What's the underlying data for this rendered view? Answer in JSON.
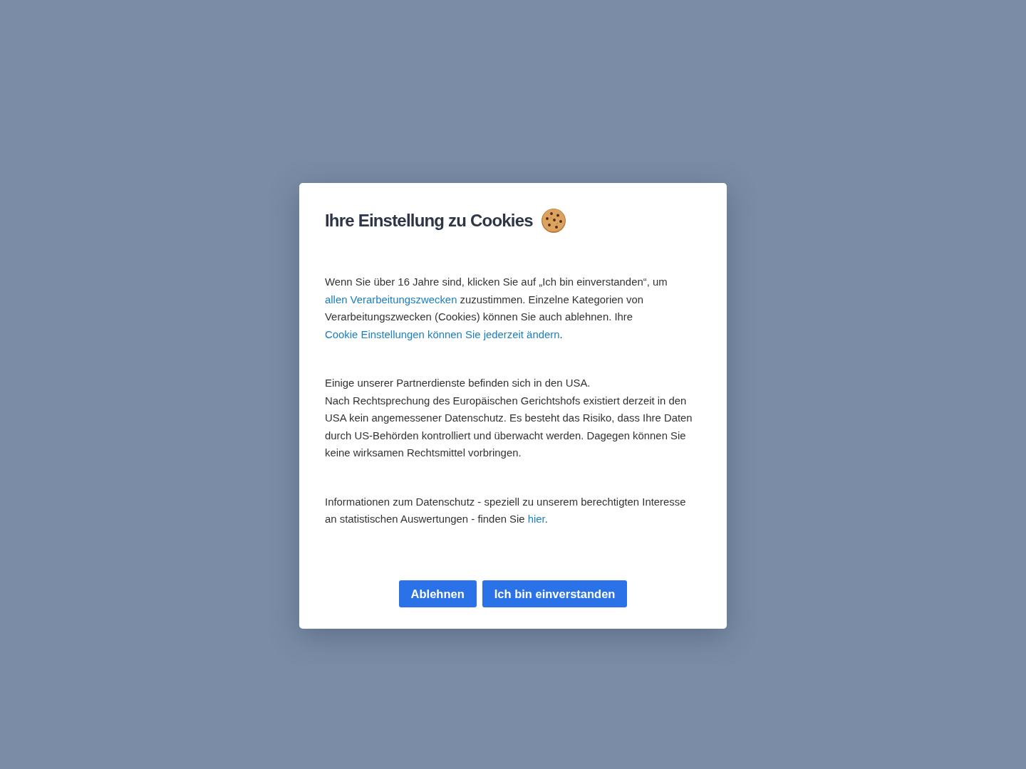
{
  "dialog": {
    "title": "Ihre Einstellung zu Cookies",
    "paragraphs": [
      {
        "segments": [
          {
            "kind": "text",
            "text": "Wenn Sie über 16 Jahre sind, klicken Sie auf „Ich bin einverstanden“, um "
          },
          {
            "kind": "link",
            "text": "allen Verarbeitungszwecken"
          },
          {
            "kind": "text",
            "text": " zuzustimmen. Einzelne Kategorien von Verarbeitungszwecken (Cookies) können Sie auch ablehnen. Ihre "
          },
          {
            "kind": "link",
            "text": "Cookie Einstellungen können Sie jederzeit ändern"
          },
          {
            "kind": "text",
            "text": "."
          }
        ]
      },
      {
        "segments": [
          {
            "kind": "text",
            "text": "Einige unserer Partnerdienste befinden sich in den USA."
          },
          {
            "kind": "line_break"
          },
          {
            "kind": "text",
            "text": "Nach Rechtsprechung des Europäischen Gerichtshofs existiert derzeit in den USA kein angemessener Datenschutz. Es besteht das Risiko, dass Ihre Daten durch US-Behörden kontrolliert und überwacht werden. Dagegen können Sie keine wirksamen Rechtsmittel vorbringen."
          }
        ]
      },
      {
        "segments": [
          {
            "kind": "text",
            "text": "Informationen zum Datenschutz - speziell zu unserem berechtigten Interesse an statistischen Auswertungen - finden Sie "
          },
          {
            "kind": "link",
            "text": "hier"
          },
          {
            "kind": "text",
            "text": "."
          }
        ]
      }
    ],
    "buttons": [
      {
        "label": "Ablehnen"
      },
      {
        "label": "Ich bin einverstanden"
      }
    ]
  }
}
